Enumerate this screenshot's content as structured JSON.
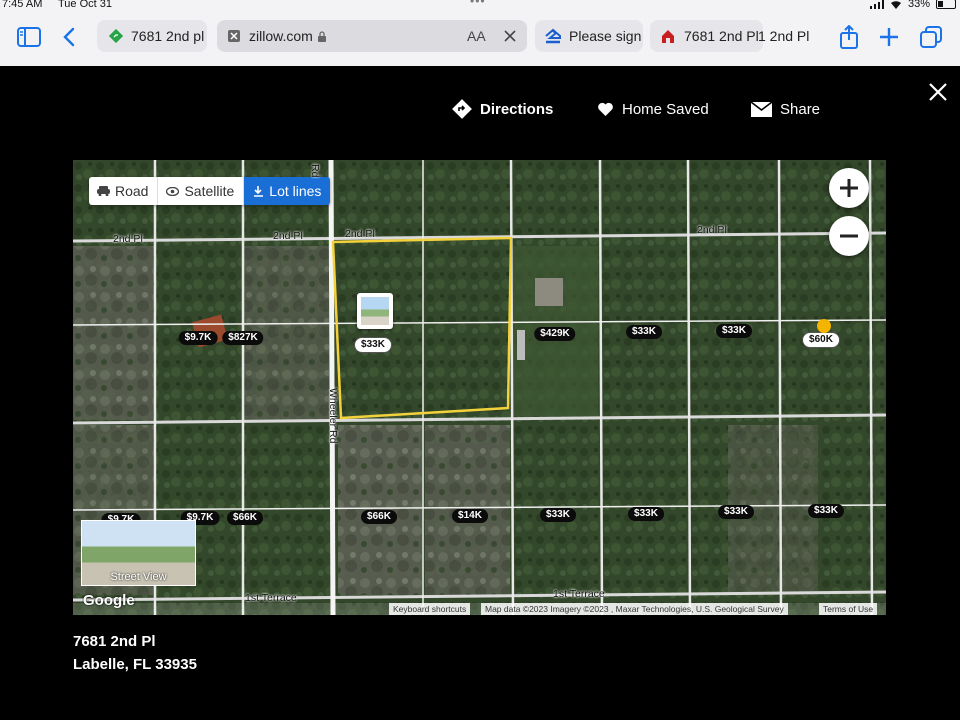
{
  "status": {
    "time": "7:45 AM",
    "date": "Tue Oct 31",
    "battery": "33%",
    "battery_level": 0.33
  },
  "browser": {
    "tabs": [
      {
        "label": "7681 2nd pl"
      },
      {
        "label": "zillow.com",
        "text_size": "AA"
      },
      {
        "label": "Please sign"
      },
      {
        "label": "7681 2nd Pl"
      },
      {
        "label": "1 2nd Pl"
      }
    ]
  },
  "modal": {
    "directions": "Directions",
    "home_saved": "Home Saved",
    "share": "Share"
  },
  "map": {
    "types": {
      "road": "Road",
      "satellite": "Satellite",
      "lot_lines": "Lot lines",
      "active": "lot_lines"
    },
    "roads": {
      "second_pl_1": "2nd Pl",
      "second_pl_2": "2nd Pl",
      "second_pl_3": "2nd Pl",
      "second_pl_4": "2nd Pl",
      "wheeler_rd": "Wheeler Rd",
      "first_terrace": "1st Terrace",
      "first_terrace_2": "1st Terrace",
      "rd_top": "Rd"
    },
    "prices": [
      "$9.7K",
      "$827K",
      "$33K",
      "$429K",
      "$33K",
      "$33K",
      "$60K",
      "$9.7K",
      "$66K",
      "$66K",
      "$14K",
      "$33K",
      "$33K",
      "$33K",
      "$33K",
      "$9.7K"
    ],
    "street_view": "Street View",
    "google_logo": "Google",
    "attribution": {
      "shortcuts": "Keyboard shortcuts",
      "data": "Map data ©2023 Imagery ©2023 , Maxar Technologies, U.S. Geological Survey",
      "terms": "Terms of Use"
    },
    "colors": {
      "lot_outline": "#f2d13b",
      "active_type": "#1a6fd6",
      "highlight_pin": "#f5b400"
    }
  },
  "address": {
    "line1": "7681 2nd Pl",
    "line2": "Labelle, FL 33935"
  }
}
